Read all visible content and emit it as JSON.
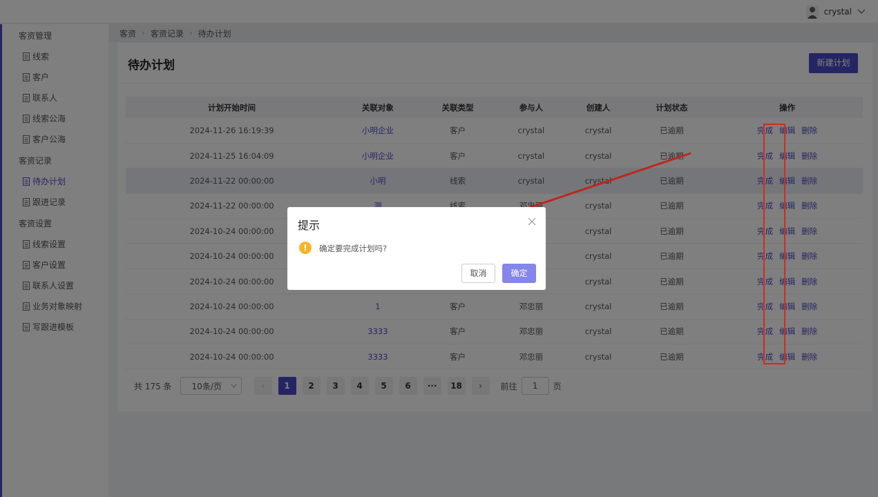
{
  "header": {
    "user_name": "crystal"
  },
  "sidebar": {
    "groups": [
      {
        "label": "客资管理",
        "items": [
          "线索",
          "客户",
          "联系人",
          "线索公海",
          "客户公海"
        ]
      },
      {
        "label": "客资记录",
        "items": [
          "待办计划",
          "跟进记录"
        ]
      },
      {
        "label": "客资设置",
        "items": [
          "线索设置",
          "客户设置",
          "联系人设置",
          "业务对象映射",
          "写跟进模板"
        ]
      }
    ],
    "active_item": "待办计划"
  },
  "breadcrumb": [
    "客资",
    "客资记录",
    "待办计划"
  ],
  "page": {
    "title": "待办计划",
    "new_button": "新建计划"
  },
  "table": {
    "columns": [
      "计划开始时间",
      "关联对象",
      "关联类型",
      "参与人",
      "创建人",
      "计划状态",
      "操作"
    ],
    "actions": [
      "完成",
      "编辑",
      "删除"
    ],
    "rows": [
      {
        "start": "2024-11-26 16:19:39",
        "object": "小明企业",
        "type": "客户",
        "participant": "crystal",
        "creator": "crystal",
        "status": "已逾期"
      },
      {
        "start": "2024-11-25 16:04:09",
        "object": "小明企业",
        "type": "客户",
        "participant": "crystal",
        "creator": "crystal",
        "status": "已逾期"
      },
      {
        "start": "2024-11-22 00:00:00",
        "object": "小明",
        "type": "线索",
        "participant": "crystal",
        "creator": "crystal",
        "status": "已逾期"
      },
      {
        "start": "2024-11-22 00:00:00",
        "object": "测",
        "type": "线索",
        "participant": "邓忠丽",
        "creator": "crystal",
        "status": "已逾期"
      },
      {
        "start": "2024-10-24 00:00:00",
        "object": "",
        "type": "",
        "participant": "",
        "creator": "crystal",
        "status": "已逾期"
      },
      {
        "start": "2024-10-24 00:00:00",
        "object": "",
        "type": "",
        "participant": "",
        "creator": "crystal",
        "status": "已逾期"
      },
      {
        "start": "2024-10-24 00:00:00",
        "object": "",
        "type": "",
        "participant": "",
        "creator": "crystal",
        "status": "已逾期"
      },
      {
        "start": "2024-10-24 00:00:00",
        "object": "1",
        "type": "客户",
        "participant": "邓忠丽",
        "creator": "crystal",
        "status": "已逾期"
      },
      {
        "start": "2024-10-24 00:00:00",
        "object": "3333",
        "type": "客户",
        "participant": "邓忠丽",
        "creator": "crystal",
        "status": "已逾期"
      },
      {
        "start": "2024-10-24 00:00:00",
        "object": "3333",
        "type": "客户",
        "participant": "邓忠丽",
        "creator": "crystal",
        "status": "已逾期"
      }
    ]
  },
  "pagination": {
    "total_text": "共 175 条",
    "page_size": "10条/页",
    "pages": [
      "1",
      "2",
      "3",
      "4",
      "5",
      "6",
      "···",
      "18"
    ],
    "current": "1",
    "prev": "‹",
    "next": "›",
    "goto_label": "前往",
    "goto_value": "1",
    "goto_suffix": "页"
  },
  "dialog": {
    "title": "提示",
    "message": "确定要完成计划吗?",
    "warn_glyph": "!",
    "cancel": "取消",
    "confirm": "确定"
  }
}
